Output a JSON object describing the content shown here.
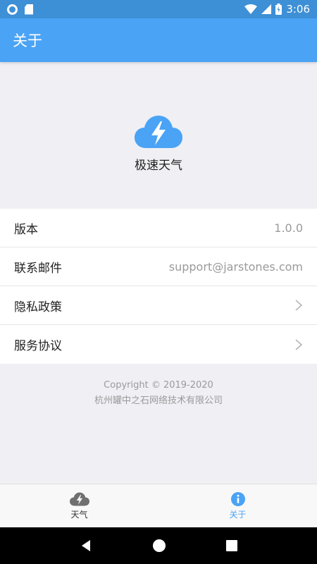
{
  "status_bar": {
    "time": "3:06"
  },
  "app_bar": {
    "title": "关于"
  },
  "hero": {
    "app_name": "极速天气",
    "icon": "cloud-lightning-icon",
    "accent": "#4aa3f5"
  },
  "info_list": [
    {
      "label": "版本",
      "value": "1.0.0"
    },
    {
      "label": "联系邮件",
      "value": "support@jarstones.com"
    },
    {
      "label": "隐私政策",
      "value": ""
    },
    {
      "label": "服务协议",
      "value": ""
    }
  ],
  "footer": {
    "copyright": "Copyright © 2019-2020",
    "company": "杭州罐中之石网络技术有限公司"
  },
  "tabs": [
    {
      "label": "天气",
      "icon": "cloud-lightning-icon",
      "active": false
    },
    {
      "label": "关于",
      "icon": "info-icon",
      "active": true
    }
  ],
  "colors": {
    "status_bar": "#3d8fd6",
    "app_bar": "#4aa3f5",
    "background": "#efeff4",
    "tab_active": "#4aa3f5"
  }
}
